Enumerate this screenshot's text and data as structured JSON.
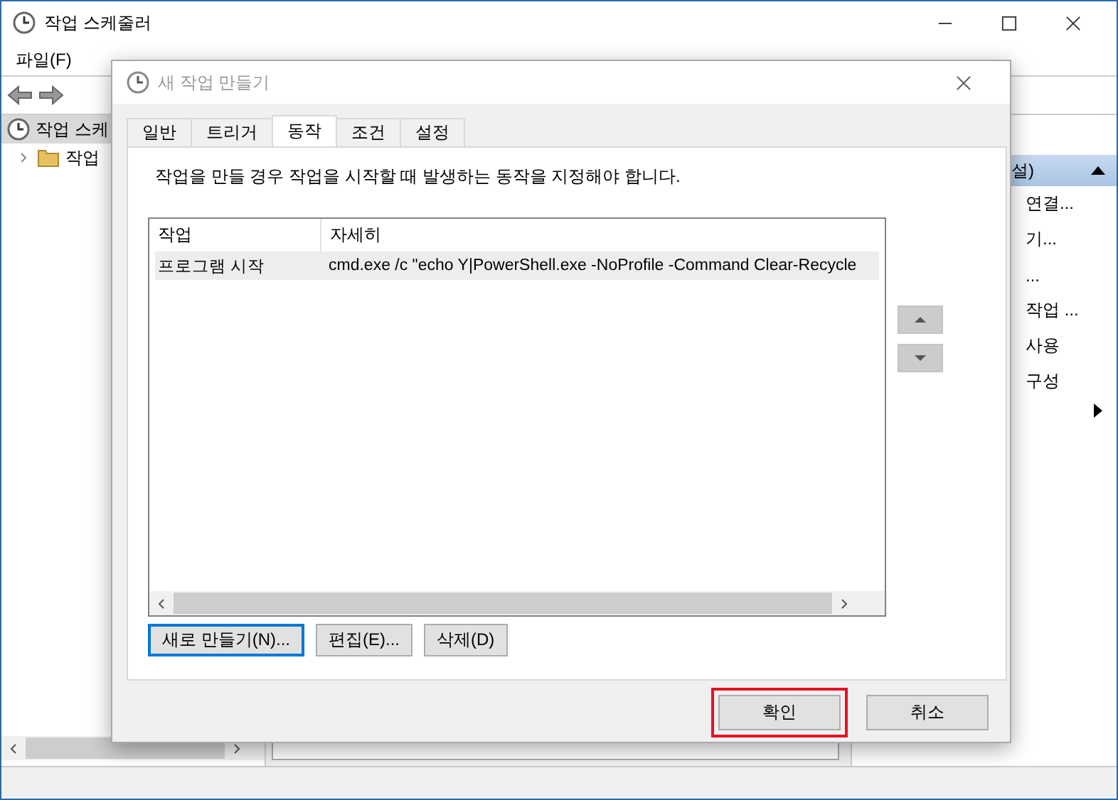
{
  "window": {
    "title": "작업 스케줄러"
  },
  "menu": [
    "파일(F)"
  ],
  "tree": [
    {
      "label": "작업 스케",
      "children": [
        {
          "label": "작업"
        }
      ]
    }
  ],
  "actions_pane": {
    "header": "설)",
    "items": [
      "연결...",
      "기...",
      "...",
      "작업 ...",
      "사용",
      "구성"
    ]
  },
  "dialog": {
    "title": "새 작업 만들기",
    "tabs": [
      {
        "label": "일반",
        "selected": false
      },
      {
        "label": "트리거",
        "selected": false
      },
      {
        "label": "동작",
        "selected": true
      },
      {
        "label": "조건",
        "selected": false
      },
      {
        "label": "설정",
        "selected": false
      }
    ],
    "description": "작업을 만들 경우 작업을 시작할 때 발생하는 동작을 지정해야 합니다.",
    "table": {
      "columns": [
        "작업",
        "자세히"
      ],
      "rows": [
        {
          "cells": [
            "프로그램 시작",
            "cmd.exe /c \"echo Y|PowerShell.exe -NoProfile -Command Clear-Recycle"
          ],
          "selected": true
        }
      ]
    },
    "list_buttons": [
      {
        "label": "새로 만들기(N)...",
        "focused": true
      },
      {
        "label": "편집(E)...",
        "focused": false
      },
      {
        "label": "삭제(D)",
        "focused": false
      }
    ],
    "footer_buttons": [
      {
        "label": "확인",
        "highlighted": true
      },
      {
        "label": "취소",
        "highlighted": false
      }
    ]
  }
}
